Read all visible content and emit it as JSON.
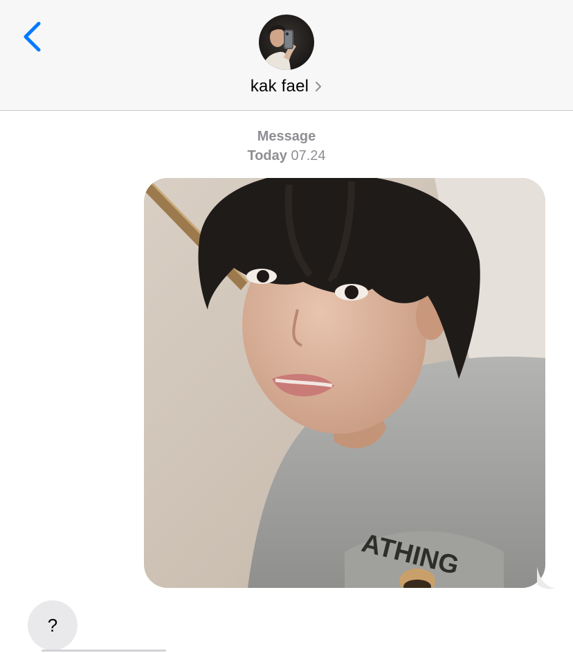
{
  "header": {
    "back_icon": "chevron-left-icon",
    "avatar_icon": "contact-avatar-photo",
    "contact_name": "kak fael",
    "details_icon": "chevron-right-icon"
  },
  "thread": {
    "timestamp_label": "Message",
    "timestamp_day": "Today",
    "timestamp_time": "07.24",
    "outgoing_photo": "selfie-photo",
    "incoming_text": "?"
  },
  "colors": {
    "accent": "#007aff",
    "header_bg": "#f7f7f7",
    "incoming_bubble": "#e9e9eb",
    "meta_text": "#8e8e93"
  }
}
